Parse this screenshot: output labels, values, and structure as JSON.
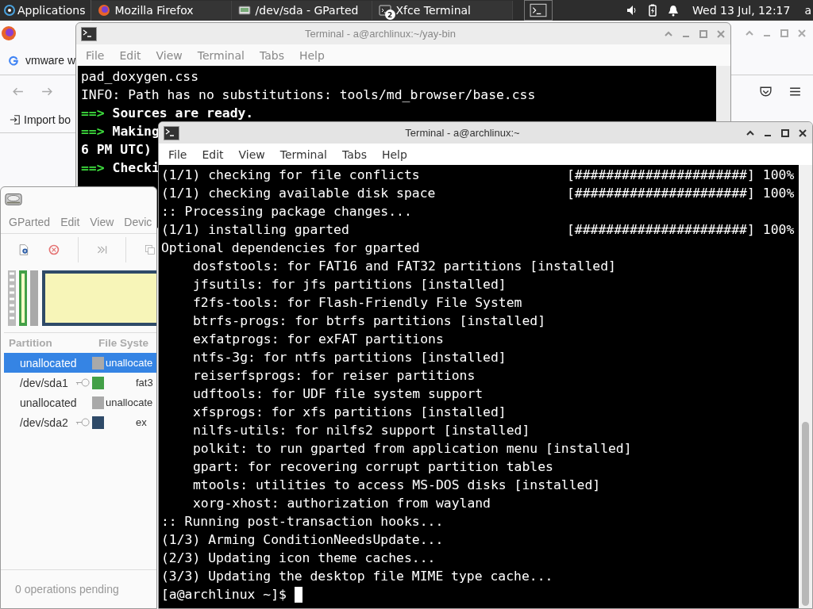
{
  "panel": {
    "apps_label": "Applications",
    "tasks": [
      {
        "label": "Mozilla Firefox"
      },
      {
        "label": "/dev/sda - GParted"
      },
      {
        "label": "Xfce Terminal",
        "badge": "2"
      }
    ],
    "clock": "Wed 13 Jul, 12:17",
    "user": "a"
  },
  "firefox": {
    "tab": "vmware w",
    "bookmark": "Import bo"
  },
  "back_terminal": {
    "title": "Terminal - a@archlinux:~/yay-bin",
    "menu": [
      "File",
      "Edit",
      "View",
      "Terminal",
      "Tabs",
      "Help"
    ],
    "lines": [
      {
        "kind": "plain",
        "text": "pad_doxygen.css"
      },
      {
        "kind": "plain",
        "text": "INFO: Path has no substitutions: tools/md_browser/base.css"
      },
      {
        "kind": "arrow",
        "arrow": "==>",
        "text": "Sources are ready."
      },
      {
        "kind": "arrow",
        "arrow": "==>",
        "text": "Making"
      },
      {
        "kind": "bold",
        "text": "6 PM UTC)"
      },
      {
        "kind": "arrow",
        "arrow": "==>",
        "text": "Checki"
      }
    ]
  },
  "gparted": {
    "menu": [
      "GParted",
      "Edit",
      "View",
      "Devic"
    ],
    "columns": [
      "Partition",
      "File Syste"
    ],
    "rows": [
      {
        "partition": "unallocated",
        "mounted": false,
        "color": "#a9a9a9",
        "filesystem": "unallocate",
        "selected": true
      },
      {
        "partition": "/dev/sda1",
        "mounted": true,
        "color": "#43a047",
        "filesystem": "fat3",
        "selected": false
      },
      {
        "partition": "unallocated",
        "mounted": false,
        "color": "#a9a9a9",
        "filesystem": "unallocate",
        "selected": false
      },
      {
        "partition": "/dev/sda2",
        "mounted": true,
        "color": "#2e4a68",
        "filesystem": "ex",
        "selected": false
      }
    ],
    "status": "0 operations pending"
  },
  "terminal": {
    "title": "Terminal - a@archlinux:~",
    "menu": [
      "File",
      "Edit",
      "View",
      "Terminal",
      "Tabs",
      "Help"
    ],
    "lines": [
      {
        "kind": "progress",
        "text": "(1/1) checking for file conflicts",
        "bar": "[######################]",
        "pct": "100%"
      },
      {
        "kind": "progress",
        "text": "(1/1) checking available disk space",
        "bar": "[######################]",
        "pct": "100%"
      },
      {
        "kind": "plain",
        "text": ":: Processing package changes..."
      },
      {
        "kind": "progress",
        "text": "(1/1) installing gparted",
        "bar": "[######################]",
        "pct": "100%"
      },
      {
        "kind": "plain",
        "text": "Optional dependencies for gparted"
      },
      {
        "kind": "dep",
        "text": "dosfstools: for FAT16 and FAT32 partitions [installed]"
      },
      {
        "kind": "dep",
        "text": "jfsutils: for jfs partitions [installed]"
      },
      {
        "kind": "dep",
        "text": "f2fs-tools: for Flash-Friendly File System"
      },
      {
        "kind": "dep",
        "text": "btrfs-progs: for btrfs partitions [installed]"
      },
      {
        "kind": "dep",
        "text": "exfatprogs: for exFAT partitions"
      },
      {
        "kind": "dep",
        "text": "ntfs-3g: for ntfs partitions [installed]"
      },
      {
        "kind": "dep",
        "text": "reiserfsprogs: for reiser partitions"
      },
      {
        "kind": "dep",
        "text": "udftools: for UDF file system support"
      },
      {
        "kind": "dep",
        "text": "xfsprogs: for xfs partitions [installed]"
      },
      {
        "kind": "dep",
        "text": "nilfs-utils: for nilfs2 support [installed]"
      },
      {
        "kind": "dep",
        "text": "polkit: to run gparted from application menu [installed]"
      },
      {
        "kind": "dep",
        "text": "gpart: for recovering corrupt partition tables"
      },
      {
        "kind": "dep",
        "text": "mtools: utilities to access MS-DOS disks [installed]"
      },
      {
        "kind": "dep",
        "text": "xorg-xhost: authorization from wayland"
      },
      {
        "kind": "plain",
        "text": ":: Running post-transaction hooks..."
      },
      {
        "kind": "plain",
        "text": "(1/3) Arming ConditionNeedsUpdate..."
      },
      {
        "kind": "plain",
        "text": "(2/3) Updating icon theme caches..."
      },
      {
        "kind": "plain",
        "text": "(3/3) Updating the desktop file MIME type cache..."
      }
    ],
    "prompt": "[a@archlinux ~]$"
  }
}
